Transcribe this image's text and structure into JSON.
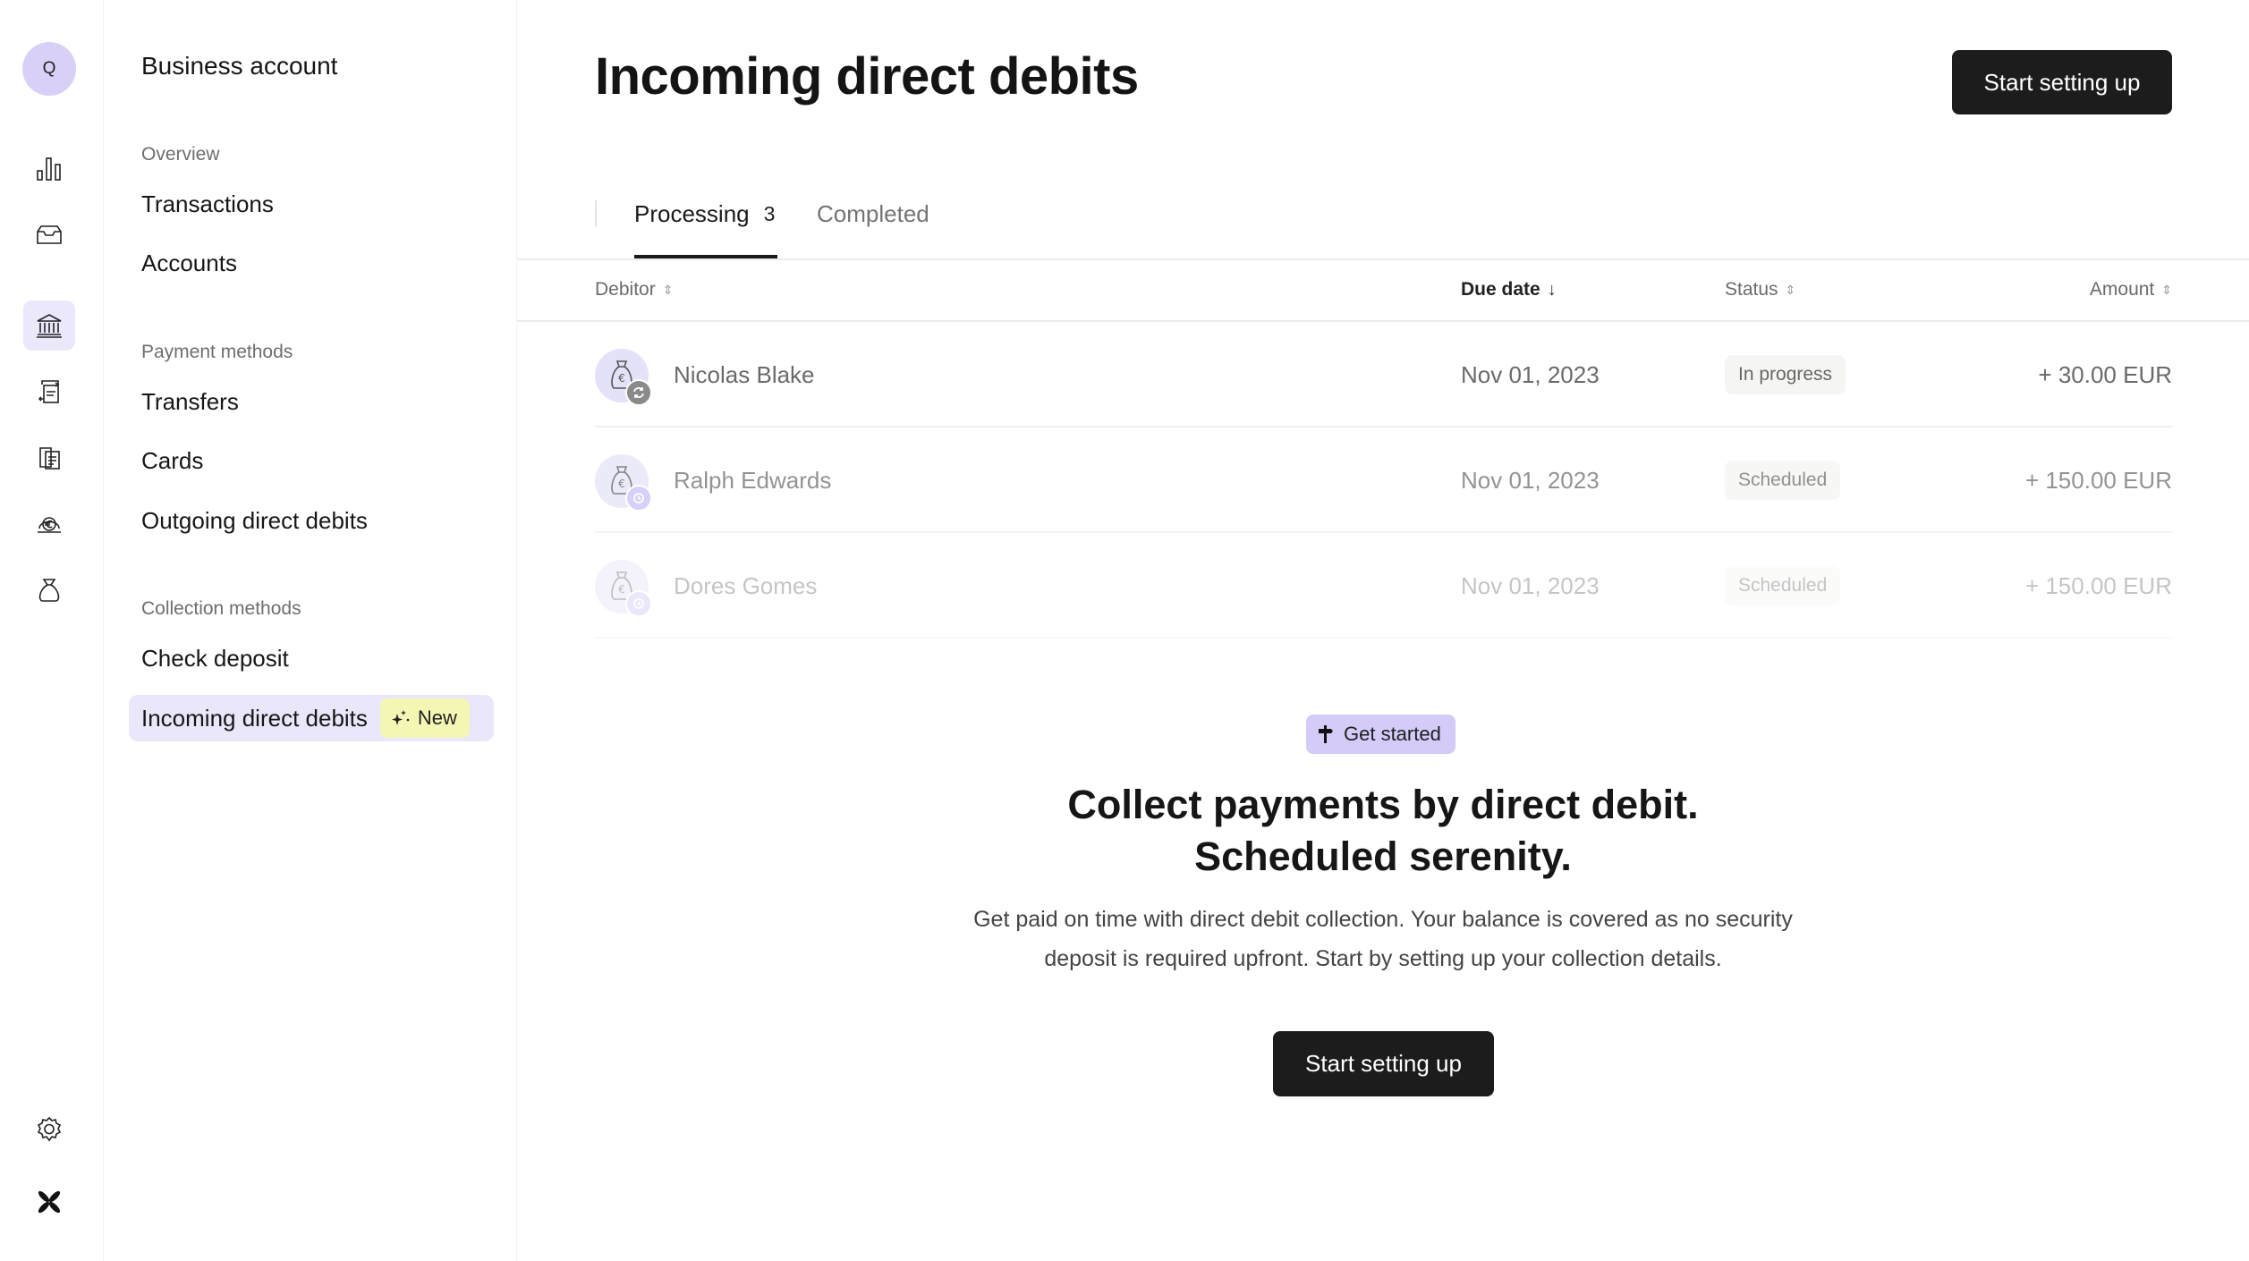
{
  "rail": {
    "avatar_initial": "Q",
    "icons": [
      "bar-chart-icon",
      "inbox-icon",
      "bank-icon",
      "transfer-icon",
      "receipts-icon",
      "euro-bag-icon",
      "money-bag-icon",
      "gear-icon",
      "brand-logo-icon"
    ],
    "active_icon": "bank-icon"
  },
  "sidebar": {
    "title": "Business account",
    "sections": [
      {
        "label": "Overview",
        "items": [
          {
            "label": "Transactions"
          },
          {
            "label": "Accounts"
          }
        ]
      },
      {
        "label": "Payment methods",
        "items": [
          {
            "label": "Transfers"
          },
          {
            "label": "Cards"
          },
          {
            "label": "Outgoing direct debits"
          }
        ]
      },
      {
        "label": "Collection methods",
        "items": [
          {
            "label": "Check deposit"
          },
          {
            "label": "Incoming direct debits",
            "badge": "New",
            "active": true
          }
        ]
      }
    ]
  },
  "header": {
    "title": "Incoming direct debits",
    "primary_button": "Start setting up"
  },
  "tabs": [
    {
      "label": "Processing",
      "count": "3",
      "active": true
    },
    {
      "label": "Completed",
      "active": false
    }
  ],
  "table": {
    "columns": [
      {
        "label": "Debitor",
        "sort": "⇕"
      },
      {
        "label": "Due date",
        "sort": "↓"
      },
      {
        "label": "Status",
        "sort": "⇕"
      },
      {
        "label": "Amount",
        "sort": "⇕"
      }
    ],
    "rows": [
      {
        "debitor": "Nicolas Blake",
        "due_date": "Nov 01, 2023",
        "status": "In progress",
        "amount": "+ 30.00 EUR",
        "status_icon": "sync-icon"
      },
      {
        "debitor": "Ralph Edwards",
        "due_date": "Nov 01, 2023",
        "status": "Scheduled",
        "amount": "+ 150.00 EUR",
        "status_icon": "clock-icon"
      },
      {
        "debitor": "Dores Gomes",
        "due_date": "Nov 01, 2023",
        "status": "Scheduled",
        "amount": "+ 150.00 EUR",
        "status_icon": "clock-icon"
      }
    ]
  },
  "promo": {
    "badge": "Get started",
    "headline_line1": "Collect payments by direct debit.",
    "headline_line2": "Scheduled serenity.",
    "body_line1": "Get paid on time with direct debit collection. Your balance is covered as no security",
    "body_line2": "deposit is required upfront. Start by setting up your collection details.",
    "button": "Start setting up"
  },
  "colors": {
    "accent_lavender": "#d4cbf9",
    "active_nav_bg": "#ebe7fb",
    "new_badge_bg": "#f4f6b4",
    "primary_button_bg": "#1c1c1c",
    "sync_badge": "#8a8a8a",
    "clock_badge": "#c9bff6"
  }
}
